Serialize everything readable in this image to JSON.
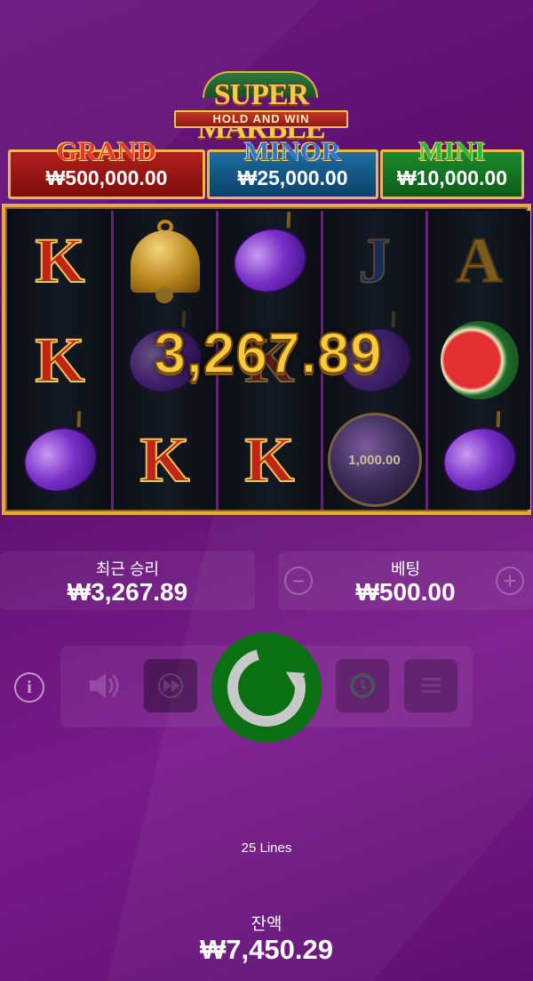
{
  "logo": {
    "title": "SUPER MARBLE",
    "subtitle": "HOLD AND WIN"
  },
  "jackpots": {
    "grand": {
      "label": "GRAND",
      "value": "₩500,000.00"
    },
    "minor": {
      "label": "MINOR",
      "value": "₩25,000.00"
    },
    "mini": {
      "label": "MINI",
      "value": "₩10,000.00"
    }
  },
  "reels": [
    [
      "K",
      "K",
      "plum"
    ],
    [
      "bell",
      "plum",
      "K"
    ],
    [
      "plum",
      "K",
      "K"
    ],
    [
      "J",
      "plum",
      "marble"
    ],
    [
      "A",
      "watermelon",
      "plum"
    ]
  ],
  "marble_value": "1,000.00",
  "win_overlay": "3,267.89",
  "last_win": {
    "label": "최근 승리",
    "value": "₩3,267.89"
  },
  "bet": {
    "label": "베팅",
    "value": "₩500.00",
    "decrease": "−",
    "increase": "+"
  },
  "info_label": "i",
  "lines_text": "25 Lines",
  "balance": {
    "label": "잔액",
    "value": "₩7,450.29"
  },
  "colors": {
    "accent_gold": "#e2ad3c",
    "spin_green": "#0b6f14",
    "background": "#6c1680"
  }
}
